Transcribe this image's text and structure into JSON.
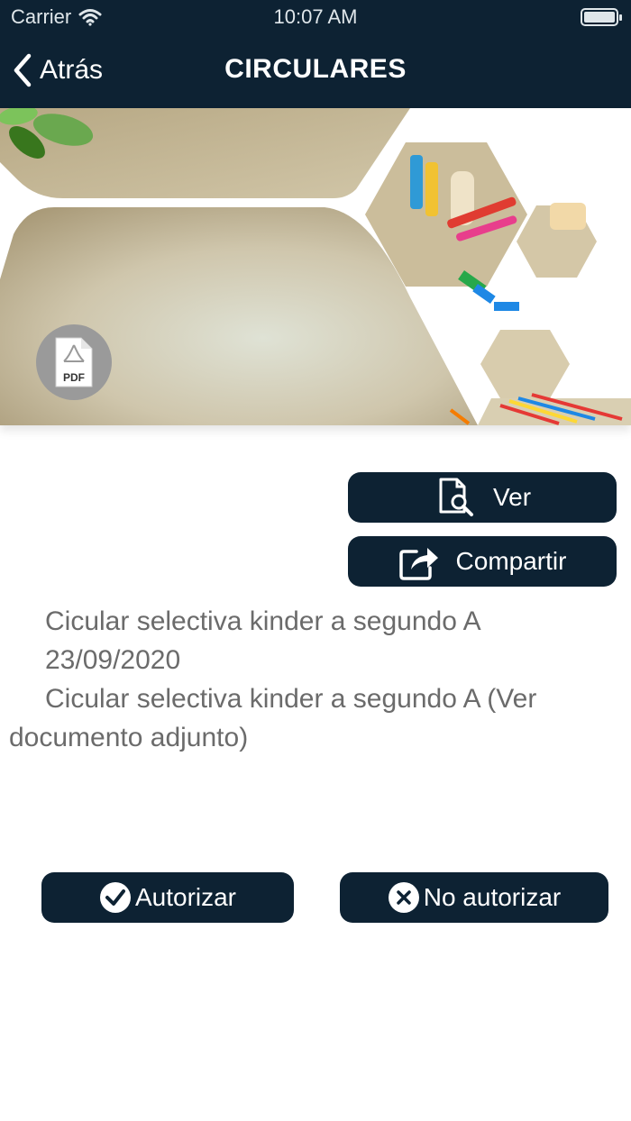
{
  "status_bar": {
    "carrier": "Carrier",
    "time": "10:07 AM"
  },
  "nav": {
    "back_label": "Atrás",
    "title": "CIRCULARES"
  },
  "banner": {
    "pdf_badge_label": "PDF"
  },
  "actions": {
    "view_label": "Ver",
    "share_label": "Compartir"
  },
  "circular": {
    "title": "Cicular selectiva kinder a segundo A",
    "date": "23/09/2020",
    "body_first": "Cicular selectiva kinder a segundo A (Ver",
    "body_rest": "documento adjunto)"
  },
  "decision": {
    "authorize_label": "Autorizar",
    "deny_label": "No autorizar"
  },
  "colors": {
    "nav_background": "#0d2233",
    "button_background": "#0d2233",
    "text_gray": "#6b6b6b"
  },
  "icons": [
    "wifi-icon",
    "battery-icon",
    "back-chevron-icon",
    "pdf-icon",
    "document-search-icon",
    "share-icon",
    "check-circle-icon",
    "x-circle-icon"
  ]
}
